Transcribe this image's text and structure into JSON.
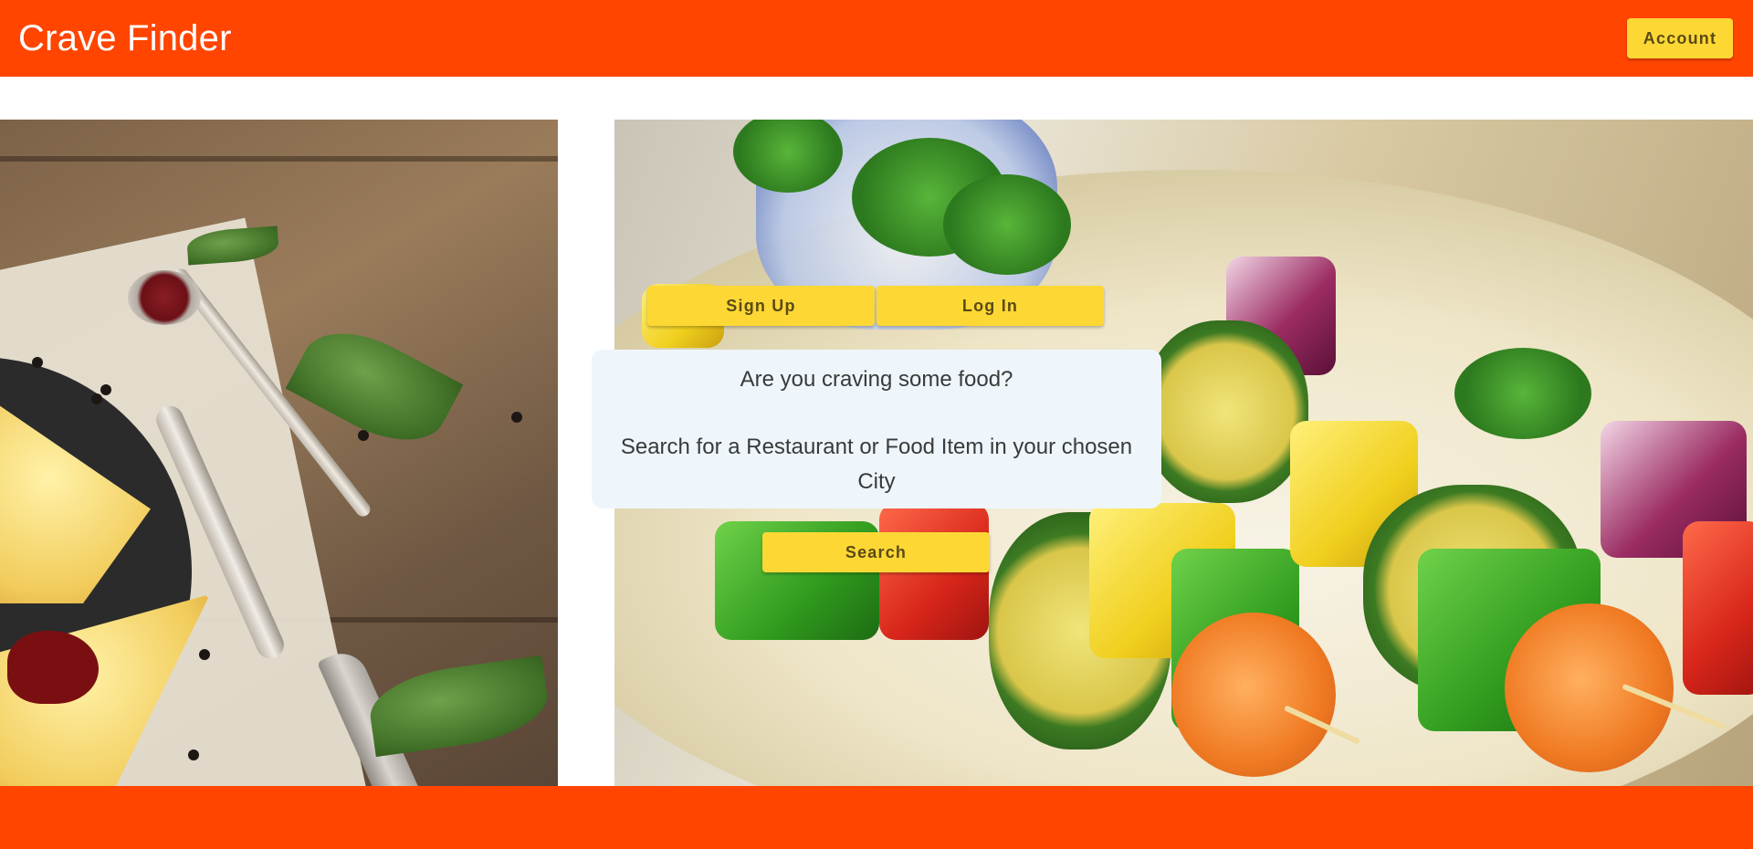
{
  "app": {
    "title": "Crave Finder"
  },
  "header": {
    "account_label": "Account"
  },
  "auth": {
    "signup_label": "Sign Up",
    "login_label": "Log In"
  },
  "hero": {
    "question": "Are you craving some food?",
    "instruction": "Search for a Restaurant or Food Item in your chosen City"
  },
  "search": {
    "button_label": "Search"
  },
  "images": {
    "left": "pizza-on-wooden-board-image",
    "right": "vegetable-skewers-image"
  },
  "colors": {
    "primary": "#ff4500",
    "accent": "#fdd835",
    "card_bg": "#eef6fc",
    "text_dark": "#3a3a3a",
    "button_text": "#5b4a14"
  }
}
